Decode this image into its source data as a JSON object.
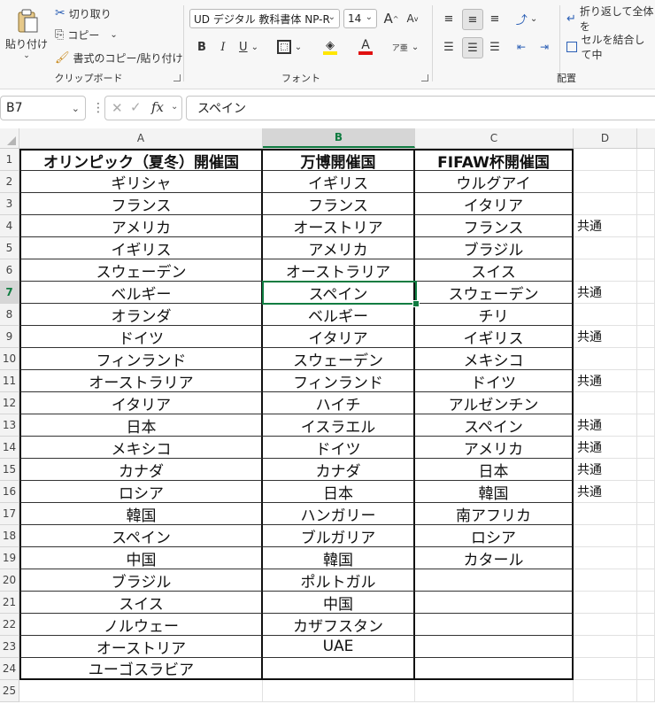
{
  "ribbon": {
    "clipboard": {
      "paste_label": "貼り付け",
      "cut_label": "切り取り",
      "copy_label": "コピー",
      "format_painter_label": "書式のコピー/貼り付け",
      "group_label": "クリップボード"
    },
    "font": {
      "font_name": "UD デジタル 教科書体 NP-R",
      "font_size": "14",
      "grow_label": "A",
      "shrink_label": "A",
      "bold_label": "B",
      "italic_label": "I",
      "underline_label": "U",
      "font_color_label": "A",
      "phonetic_label": "ア亜",
      "group_label": "フォント"
    },
    "alignment": {
      "wrap_label": "折り返して全体を",
      "merge_label": "セルを結合して中",
      "group_label": "配置"
    },
    "colors": {
      "accent": "#107c41",
      "highlight": "#ffe600",
      "font_color": "#e01010"
    }
  },
  "formula_bar": {
    "name_box": "B7",
    "formula": "スペイン"
  },
  "columns": [
    "A",
    "B",
    "C",
    "D"
  ],
  "rows": [
    {
      "n": "1",
      "a": "オリンピック（夏冬）開催国",
      "b": "万博開催国",
      "c": "FIFAW杯開催国",
      "d": ""
    },
    {
      "n": "2",
      "a": "ギリシャ",
      "b": "イギリス",
      "c": "ウルグアイ",
      "d": ""
    },
    {
      "n": "3",
      "a": "フランス",
      "b": "フランス",
      "c": "イタリア",
      "d": ""
    },
    {
      "n": "4",
      "a": "アメリカ",
      "b": "オーストリア",
      "c": "フランス",
      "d": "共通"
    },
    {
      "n": "5",
      "a": "イギリス",
      "b": "アメリカ",
      "c": "ブラジル",
      "d": ""
    },
    {
      "n": "6",
      "a": "スウェーデン",
      "b": "オーストラリア",
      "c": "スイス",
      "d": ""
    },
    {
      "n": "7",
      "a": "ベルギー",
      "b": "スペイン",
      "c": "スウェーデン",
      "d": "共通"
    },
    {
      "n": "8",
      "a": "オランダ",
      "b": "ベルギー",
      "c": "チリ",
      "d": ""
    },
    {
      "n": "9",
      "a": "ドイツ",
      "b": "イタリア",
      "c": "イギリス",
      "d": "共通"
    },
    {
      "n": "10",
      "a": "フィンランド",
      "b": "スウェーデン",
      "c": "メキシコ",
      "d": ""
    },
    {
      "n": "11",
      "a": "オーストラリア",
      "b": "フィンランド",
      "c": "ドイツ",
      "d": "共通"
    },
    {
      "n": "12",
      "a": "イタリア",
      "b": "ハイチ",
      "c": "アルゼンチン",
      "d": ""
    },
    {
      "n": "13",
      "a": "日本",
      "b": "イスラエル",
      "c": "スペイン",
      "d": "共通"
    },
    {
      "n": "14",
      "a": "メキシコ",
      "b": "ドイツ",
      "c": "アメリカ",
      "d": "共通"
    },
    {
      "n": "15",
      "a": "カナダ",
      "b": "カナダ",
      "c": "日本",
      "d": "共通"
    },
    {
      "n": "16",
      "a": "ロシア",
      "b": "日本",
      "c": "韓国",
      "d": "共通"
    },
    {
      "n": "17",
      "a": "韓国",
      "b": "ハンガリー",
      "c": "南アフリカ",
      "d": ""
    },
    {
      "n": "18",
      "a": "スペイン",
      "b": "ブルガリア",
      "c": "ロシア",
      "d": ""
    },
    {
      "n": "19",
      "a": "中国",
      "b": "韓国",
      "c": "カタール",
      "d": ""
    },
    {
      "n": "20",
      "a": "ブラジル",
      "b": "ポルトガル",
      "c": "",
      "d": ""
    },
    {
      "n": "21",
      "a": "スイス",
      "b": "中国",
      "c": "",
      "d": ""
    },
    {
      "n": "22",
      "a": "ノルウェー",
      "b": "カザフスタン",
      "c": "",
      "d": ""
    },
    {
      "n": "23",
      "a": "オーストリア",
      "b": "UAE",
      "c": "",
      "d": ""
    },
    {
      "n": "24",
      "a": "ユーゴスラビア",
      "b": "",
      "c": "",
      "d": ""
    },
    {
      "n": "25",
      "a": "",
      "b": "",
      "c": "",
      "d": ""
    }
  ]
}
